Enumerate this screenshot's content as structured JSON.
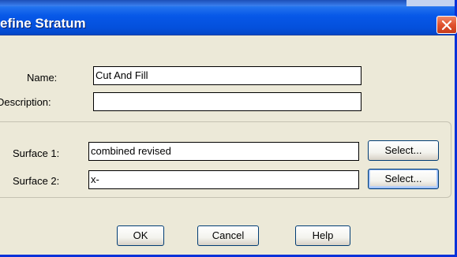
{
  "window": {
    "title": "efine Stratum",
    "colors": {
      "titlebar": "#0758e8",
      "dialog_bg": "#ece9d8",
      "close_button": "#e0522e"
    },
    "close_icon": "close-icon"
  },
  "form": {
    "name_label": "Name:",
    "name_value": "Cut And Fill",
    "description_label": "Description:",
    "description_value": ""
  },
  "surfaces": {
    "surface1_label": "Surface 1:",
    "surface1_value": "combined revised",
    "surface1_select": "Select...",
    "surface2_label": "Surface 2:",
    "surface2_value": "x-",
    "surface2_select": "Select..."
  },
  "buttons": {
    "ok": "OK",
    "cancel": "Cancel",
    "help": "Help"
  }
}
